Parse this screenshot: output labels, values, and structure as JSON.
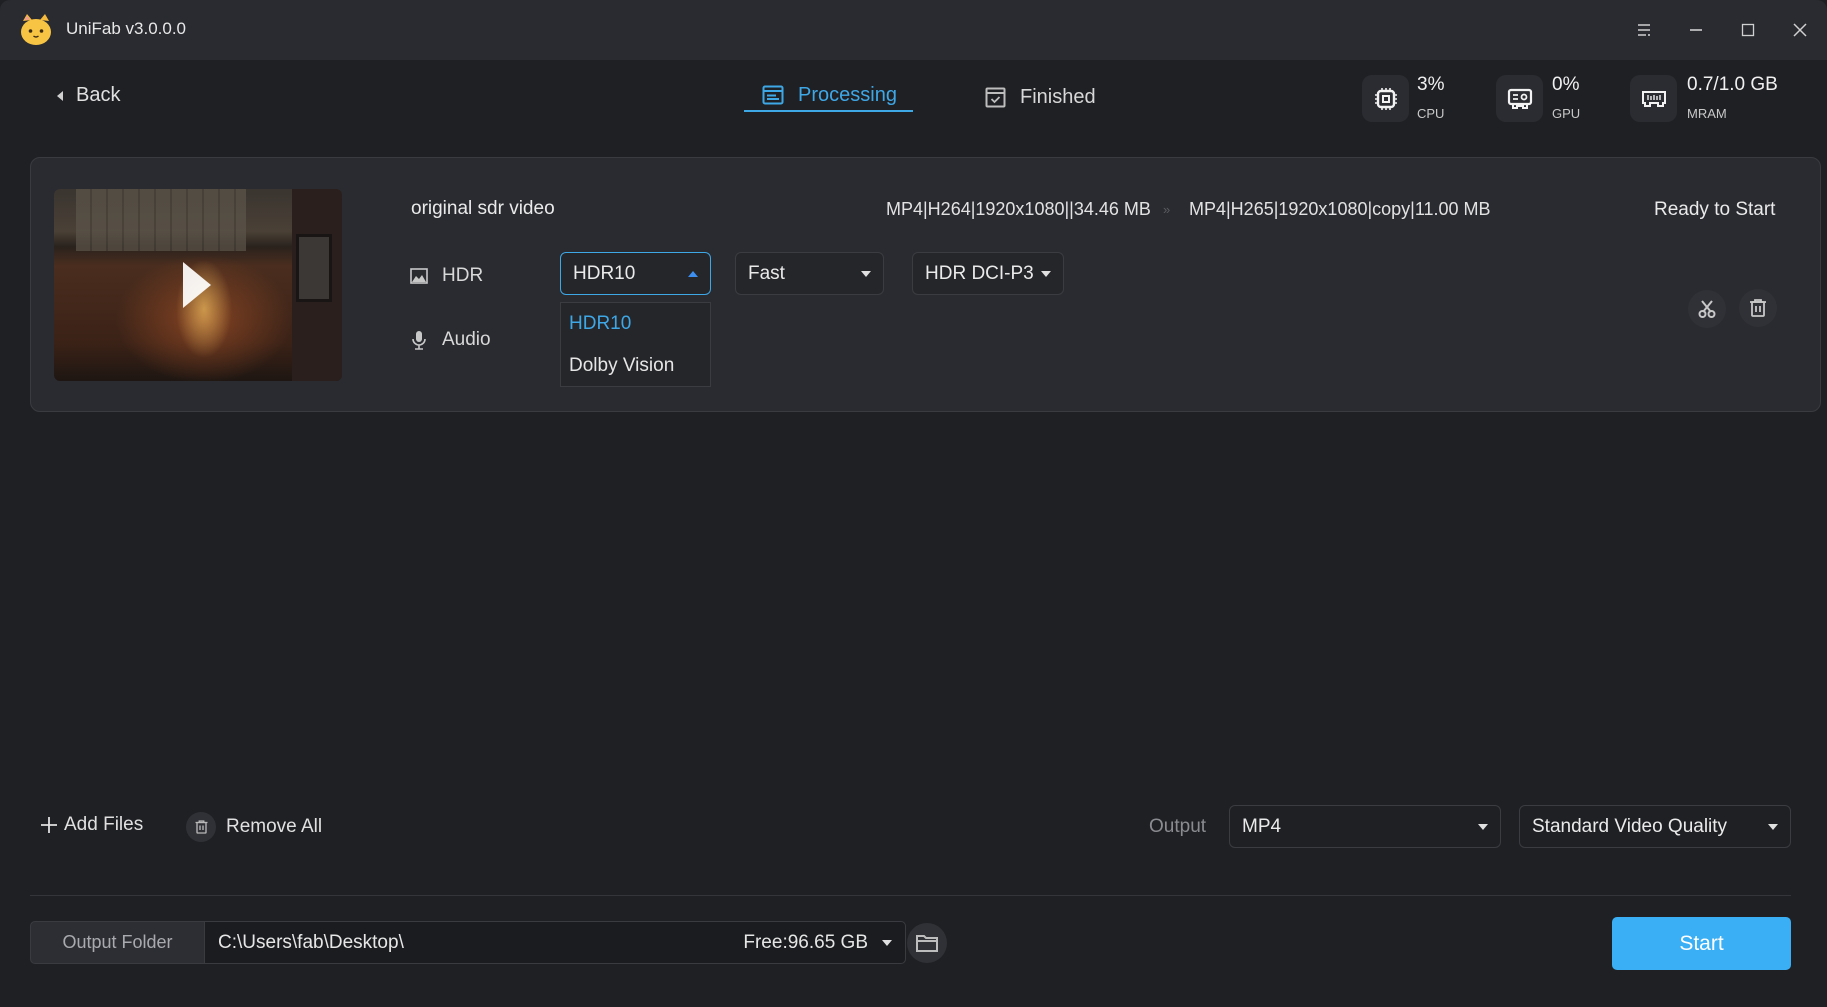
{
  "window": {
    "title": "UniFab v3.0.0.0",
    "logo_icon": "cat-face-logo",
    "controls": [
      "menu-icon",
      "minimize-icon",
      "maximize-icon",
      "close-icon"
    ]
  },
  "header": {
    "back_label": "Back",
    "tabs": [
      {
        "label": "Processing",
        "icon": "list-window-icon",
        "active": true
      },
      {
        "label": "Finished",
        "icon": "checkbox-icon",
        "active": false
      }
    ],
    "stats": [
      {
        "value": "3%",
        "label": "CPU",
        "icon": "cpu-icon"
      },
      {
        "value": "0%",
        "label": "GPU",
        "icon": "gpu-icon"
      },
      {
        "value": "0.7/1.0 GB",
        "label": "MRAM",
        "icon": "memory-icon"
      }
    ]
  },
  "task": {
    "file_name": "original sdr video",
    "source_info": "MP4|H264|1920x1080||34.46 MB",
    "arrow": "»",
    "target_info": "MP4|H265|1920x1080|copy|11.00 MB",
    "status": "Ready to Start",
    "hdr_label": "HDR",
    "audio_label": "Audio",
    "hdr_format": {
      "value": "HDR10",
      "open": true,
      "options": [
        "HDR10",
        "Dolby Vision"
      ],
      "selected_index": 0
    },
    "speed": {
      "value": "Fast"
    },
    "color_space": {
      "value": "HDR DCI-P3"
    }
  },
  "bottom": {
    "add_files_label": "Add Files",
    "remove_all_label": "Remove All",
    "output_label": "Output",
    "output_format": "MP4",
    "quality": "Standard Video Quality",
    "output_folder_label": "Output Folder",
    "output_path": "C:\\Users\\fab\\Desktop\\",
    "free_space": "Free:96.65 GB",
    "start_label": "Start"
  },
  "colors": {
    "accent": "#3ea7e6",
    "start_button": "#3aaff5",
    "background": "#1f2024",
    "card": "#2a2b30"
  }
}
